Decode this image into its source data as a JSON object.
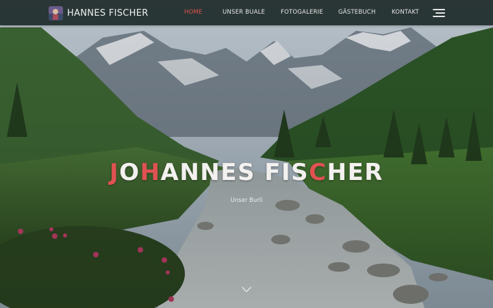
{
  "brand": {
    "title": "HANNES FISCHER"
  },
  "nav": {
    "items": [
      {
        "label": "HOME",
        "active": true
      },
      {
        "label": "UNSER BUALE",
        "active": false
      },
      {
        "label": "FOTOGALERIE",
        "active": false
      },
      {
        "label": "GÄSTEBUCH",
        "active": false
      },
      {
        "label": "KONTAKT",
        "active": false
      }
    ],
    "menu_icon": "hamburger-menu-icon"
  },
  "hero": {
    "title_parts": [
      {
        "text": "J",
        "highlight": true
      },
      {
        "text": "O",
        "highlight": false
      },
      {
        "text": "H",
        "highlight": true
      },
      {
        "text": "ANNES FIS",
        "highlight": false
      },
      {
        "text": "C",
        "highlight": true
      },
      {
        "text": "HER",
        "highlight": false
      }
    ],
    "subtitle": "Unser Burli",
    "scroll_icon": "chevron-down-icon"
  },
  "colors": {
    "accent": "#e05252",
    "navbar": "#1c2a28",
    "text": "#f3f1ef"
  }
}
